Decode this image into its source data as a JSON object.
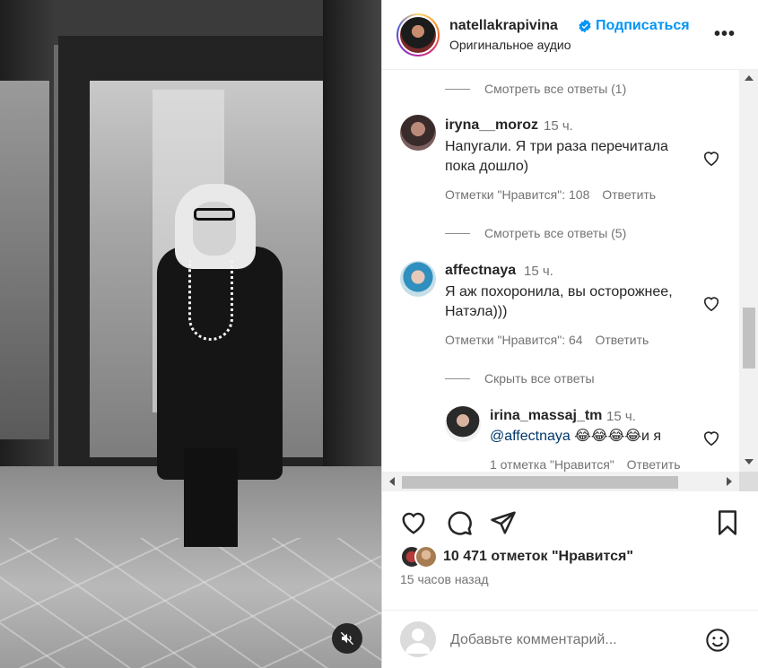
{
  "post": {
    "username": "natellakrapivina",
    "subscribe_label": "Подписаться",
    "audio": "Оригинальное аудио",
    "more_label": "•••"
  },
  "comments": [
    {
      "view_replies": "Смотреть все ответы (1)"
    },
    {
      "username": "iryna__moroz",
      "time": "15 ч.",
      "text_line1": "Напугали. Я три раза перечитала",
      "text_line2": "пока дошло)",
      "likes": "Отметки \"Нравится\": 108",
      "reply": "Ответить",
      "view_replies": "Смотреть все ответы (5)"
    },
    {
      "username": "affectnaya",
      "time": "15 ч.",
      "text_line1": "Я аж похоронила, вы осторожнее,",
      "text_line2": "Натэла)))",
      "likes": "Отметки \"Нравится\": 64",
      "reply": "Ответить",
      "hide_replies": "Скрыть все ответы"
    },
    {
      "username": "irina_massaj_tm",
      "time": "15 ч.",
      "mention": "@affectnaya",
      "text_rest": " 😂😂😂😂и я",
      "likes": "1 отметка \"Нравится\"",
      "reply": "Ответить"
    }
  ],
  "likes_summary": "10 471 отметок \"Нравится\"",
  "time_ago": "15 часов назад",
  "add_comment": {
    "placeholder": "Добавьте комментарий..."
  },
  "colors": {
    "accent": "#0095f6",
    "text": "#262626",
    "secondary": "#737373",
    "verified": "#0095f6"
  },
  "icons": {
    "like": "heart-icon",
    "comment": "comment-icon",
    "share": "send-icon",
    "save": "bookmark-icon",
    "mute": "muted-speaker-icon",
    "emoji": "emoji-icon"
  }
}
